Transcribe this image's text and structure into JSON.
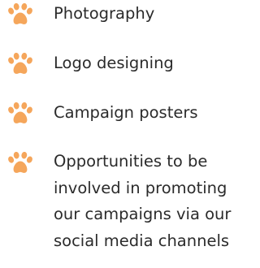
{
  "icon": {
    "name": "paw-print-icon",
    "color": "#f5a65b"
  },
  "list": {
    "items": [
      {
        "label": "Photography"
      },
      {
        "label": "Logo designing"
      },
      {
        "label": "Campaign posters"
      },
      {
        "label": "Opportunities to be involved in promoting our campaigns via our social media channels"
      }
    ]
  }
}
